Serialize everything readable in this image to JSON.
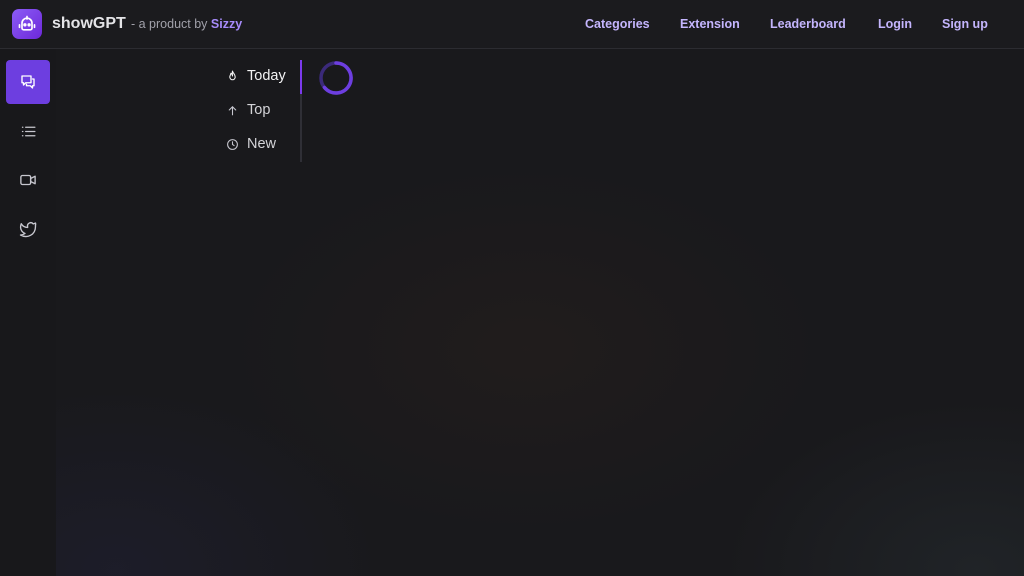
{
  "header": {
    "brand": "showGPT",
    "tagline_prefix": "- a product by",
    "tagline_brand": "Sizzy",
    "nav": [
      {
        "label": "Categories"
      },
      {
        "label": "Extension"
      },
      {
        "label": "Leaderboard"
      },
      {
        "label": "Login"
      },
      {
        "label": "Sign up"
      }
    ]
  },
  "sidebar": {
    "items": [
      {
        "icon": "chat-bubbles-icon",
        "active": true
      },
      {
        "icon": "list-icon",
        "active": false
      },
      {
        "icon": "video-icon",
        "active": false
      },
      {
        "icon": "twitter-icon",
        "active": false
      }
    ]
  },
  "filters": [
    {
      "label": "Today",
      "icon": "flame-icon",
      "active": true
    },
    {
      "label": "Top",
      "icon": "arrow-up-icon",
      "active": false
    },
    {
      "label": "New",
      "icon": "clock-icon",
      "active": false
    }
  ],
  "colors": {
    "accent": "#6d3ee0",
    "nav_link": "#c4b5fd",
    "sizzy": "#a78bfa",
    "background": "#18181b"
  },
  "loading": true
}
